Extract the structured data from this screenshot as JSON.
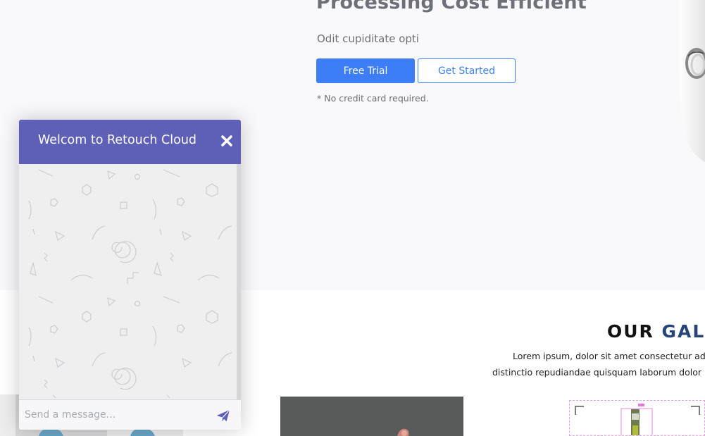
{
  "hero": {
    "title": "Processing Cost Efficient",
    "subtitle": "Odit cupiditate opti",
    "primary_button": "Free Trial",
    "secondary_button": "Get Started",
    "note": "* No credit card required."
  },
  "gallery": {
    "title_part1": "OUR ",
    "title_part2": "GALLE",
    "desc_line1": "Lorem ipsum, dolor sit amet consectetur ad",
    "desc_line2": "distinctio repudiandae quisquam laborum dolor"
  },
  "chat": {
    "title": "Welcom to Retouch Cloud",
    "input_placeholder": "Send a message..."
  },
  "colors": {
    "primary": "#3d7df6",
    "chat_header": "#5e5fb7",
    "gallery_accent": "#25457a"
  },
  "icons": {
    "close": "close-icon",
    "send": "send-icon"
  }
}
